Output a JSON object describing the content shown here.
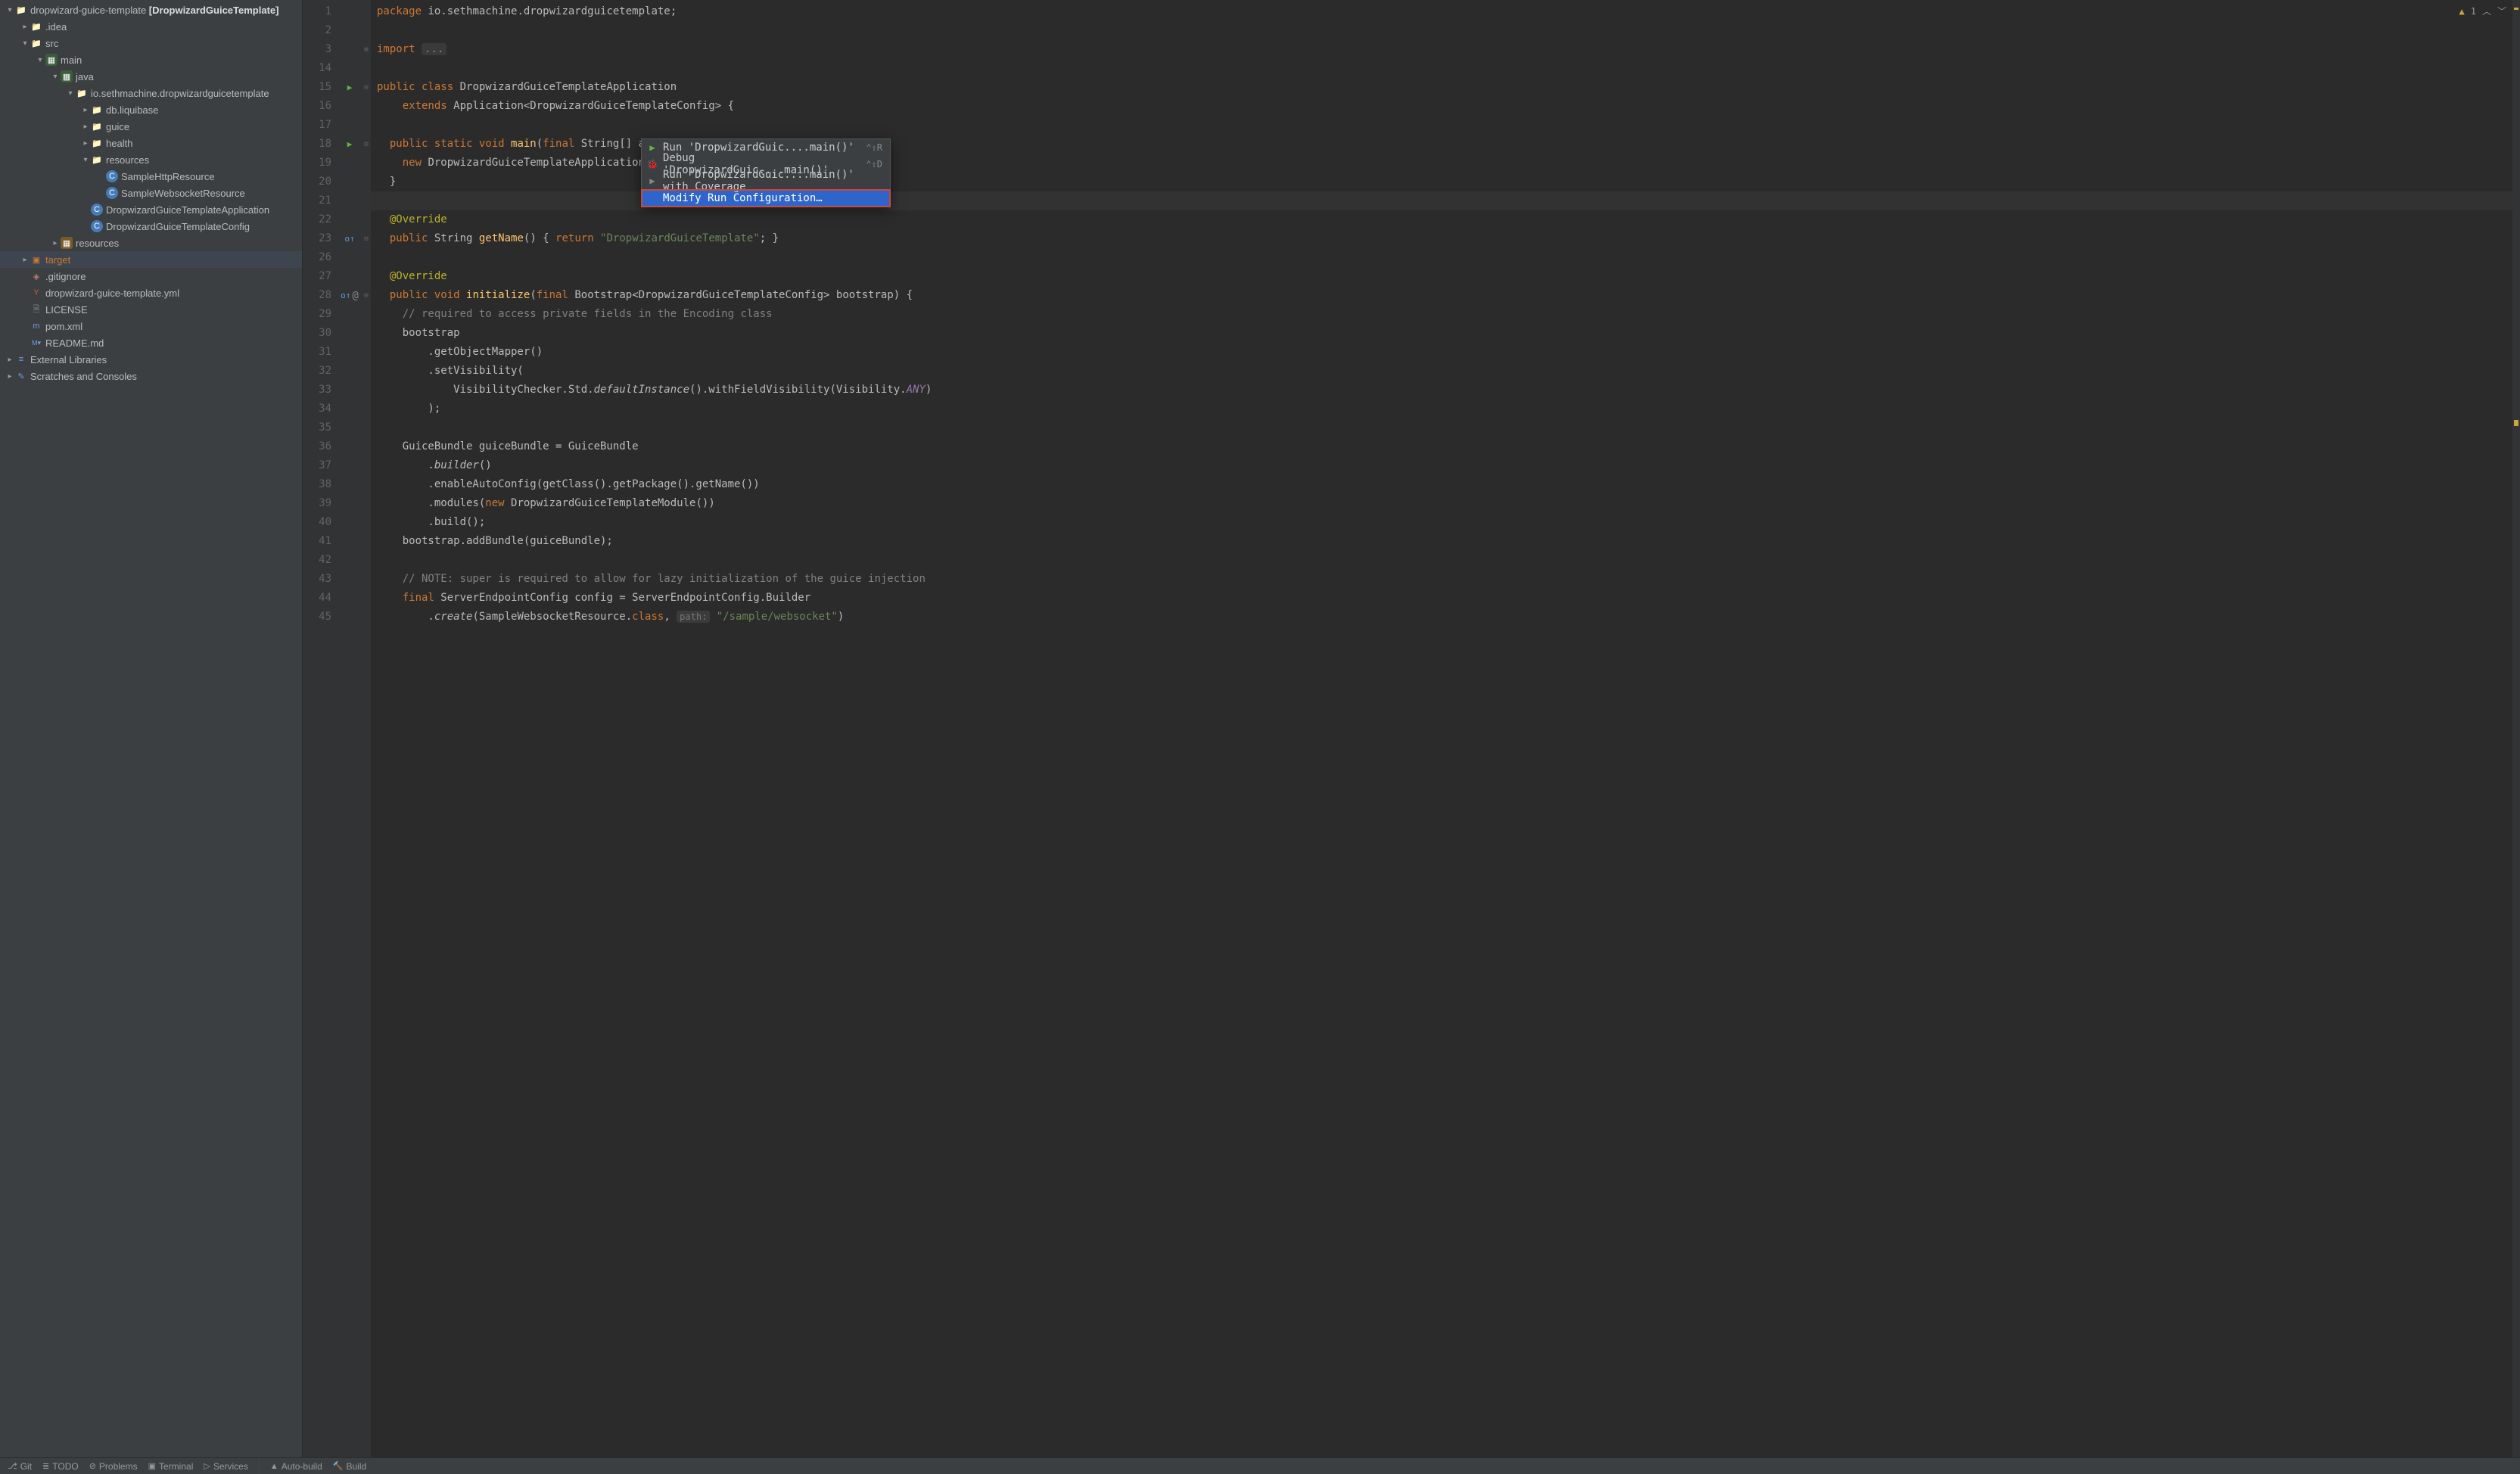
{
  "project_root": {
    "name": "dropwizard-guice-template",
    "bold": "[DropwizardGuiceTemplate]"
  },
  "tree": [
    {
      "d": 0,
      "tw": "▾",
      "ic": "folder",
      "label": "dropwizard-guice-template",
      "extra": " [DropwizardGuiceTemplate]"
    },
    {
      "d": 1,
      "tw": "▸",
      "ic": "folder",
      "label": ".idea"
    },
    {
      "d": 1,
      "tw": "▾",
      "ic": "folder",
      "label": "src"
    },
    {
      "d": 2,
      "tw": "▾",
      "ic": "srcfolder",
      "label": "main"
    },
    {
      "d": 3,
      "tw": "▾",
      "ic": "srcfolder",
      "label": "java"
    },
    {
      "d": 4,
      "tw": "▾",
      "ic": "folder",
      "label": "io.sethmachine.dropwizardguicetemplate"
    },
    {
      "d": 5,
      "tw": "▸",
      "ic": "folder",
      "label": "db.liquibase"
    },
    {
      "d": 5,
      "tw": "▸",
      "ic": "folder",
      "label": "guice"
    },
    {
      "d": 5,
      "tw": "▸",
      "ic": "folder",
      "label": "health"
    },
    {
      "d": 5,
      "tw": "▾",
      "ic": "folder",
      "label": "resources"
    },
    {
      "d": 6,
      "tw": "",
      "ic": "class",
      "label": "SampleHttpResource"
    },
    {
      "d": 6,
      "tw": "",
      "ic": "class",
      "label": "SampleWebsocketResource"
    },
    {
      "d": 5,
      "tw": "",
      "ic": "class",
      "label": "DropwizardGuiceTemplateApplication"
    },
    {
      "d": 5,
      "tw": "",
      "ic": "class",
      "label": "DropwizardGuiceTemplateConfig"
    },
    {
      "d": 3,
      "tw": "▸",
      "ic": "resfolder",
      "label": "resources"
    },
    {
      "d": 1,
      "tw": "▸",
      "ic": "target",
      "label": "target",
      "hl": true
    },
    {
      "d": 1,
      "tw": "",
      "ic": "git",
      "label": ".gitignore"
    },
    {
      "d": 1,
      "tw": "",
      "ic": "yml",
      "label": "dropwizard-guice-template.yml"
    },
    {
      "d": 1,
      "tw": "",
      "ic": "file",
      "label": "LICENSE"
    },
    {
      "d": 1,
      "tw": "",
      "ic": "xml",
      "label": "pom.xml"
    },
    {
      "d": 1,
      "tw": "",
      "ic": "md",
      "label": "README.md"
    },
    {
      "d": 0,
      "tw": "▸",
      "ic": "lib",
      "label": "External Libraries"
    },
    {
      "d": 0,
      "tw": "▸",
      "ic": "scratch",
      "label": "Scratches and Consoles"
    }
  ],
  "inspections": {
    "warnings": "1"
  },
  "code": [
    {
      "n": 1,
      "html": "<span class='kw'>package</span> io.sethmachine.dropwizardguicetemplate;"
    },
    {
      "n": 2,
      "html": ""
    },
    {
      "n": 3,
      "html": "<span class='kw'>import</span> <span class='fold'>...</span>",
      "fold": "+"
    },
    {
      "n": 14,
      "html": ""
    },
    {
      "n": 15,
      "html": "<span class='kw'>public class</span> DropwizardGuiceTemplateApplication",
      "gi": "run",
      "fold": "-"
    },
    {
      "n": 16,
      "html": "    <span class='kw'>extends</span> Application&lt;DropwizardGuiceTemplateConfig&gt; {"
    },
    {
      "n": 17,
      "html": ""
    },
    {
      "n": 18,
      "html": "  <span class='kw'>public static void</span> <span class='fn'>main</span>(<span class='kw'>final</span> String[] args) <span class='kw'>throws</span> Exception {",
      "gi": "run",
      "fold": "-"
    },
    {
      "n": 19,
      "html": "    <span class='kw'>new</span> DropwizardGuiceTemplateApplication().run(args);"
    },
    {
      "n": 20,
      "html": "  }"
    },
    {
      "n": 21,
      "html": "",
      "caret": true
    },
    {
      "n": 22,
      "html": "  <span class='ann'>@Override</span>"
    },
    {
      "n": 23,
      "html": "  <span class='kw'>public</span> String <span class='fn'>getName</span>() { <span class='kw'>return</span> <span class='str'>\"DropwizardGuiceTemplate\"</span>; }",
      "gi": "ov",
      "fold": "-"
    },
    {
      "n": 26,
      "html": ""
    },
    {
      "n": 27,
      "html": "  <span class='ann'>@Override</span>"
    },
    {
      "n": 28,
      "html": "  <span class='kw'>public void</span> <span class='fn'>initialize</span>(<span class='kw'>final</span> Bootstrap&lt;DropwizardGuiceTemplateConfig&gt; bootstrap) {",
      "gi": "ov",
      "giextra": "@",
      "fold": "-"
    },
    {
      "n": 29,
      "html": "    <span class='com'>// required to access private fields in the Encoding class</span>"
    },
    {
      "n": 30,
      "html": "    bootstrap"
    },
    {
      "n": 31,
      "html": "        .getObjectMapper()"
    },
    {
      "n": 32,
      "html": "        .setVisibility("
    },
    {
      "n": 33,
      "html": "            VisibilityChecker.Std.<span class='it'>defaultInstance</span>().withFieldVisibility(Visibility.<span class='fld it'>ANY</span>)"
    },
    {
      "n": 34,
      "html": "        );"
    },
    {
      "n": 35,
      "html": ""
    },
    {
      "n": 36,
      "html": "    GuiceBundle guiceBundle = GuiceBundle"
    },
    {
      "n": 37,
      "html": "        .<span class='it'>builder</span>()"
    },
    {
      "n": 38,
      "html": "        .enableAutoConfig(getClass().getPackage().getName())"
    },
    {
      "n": 39,
      "html": "        .modules(<span class='kw'>new</span> DropwizardGuiceTemplateModule())"
    },
    {
      "n": 40,
      "html": "        .build();"
    },
    {
      "n": 41,
      "html": "    bootstrap.addBundle(guiceBundle);"
    },
    {
      "n": 42,
      "html": ""
    },
    {
      "n": 43,
      "html": "    <span class='com'>// NOTE: super is required to allow for lazy initialization of the guice injection</span>"
    },
    {
      "n": 44,
      "html": "    <span class='kw'>final</span> ServerEndpointConfig config = ServerEndpointConfig.Builder"
    },
    {
      "n": 45,
      "html": "        .<span class='it'>create</span>(SampleWebsocketResource.<span class='kw'>class</span>, <span class='param-hint'>path:</span> <span class='str'>\"/sample/websocket\"</span>)"
    }
  ],
  "context_menu": {
    "items": [
      {
        "icon": "▶",
        "iconColor": "#62b543",
        "label": "Run 'DropwizardGuic....main()'",
        "shortcut": "⌃⇧R"
      },
      {
        "icon": "🐞",
        "iconColor": "#62b543",
        "label": "Debug 'DropwizardGuic....main()'",
        "shortcut": "⌃⇧D"
      },
      {
        "icon": "▶",
        "iconColor": "#888",
        "label": "Run 'DropwizardGuic....main()' with Coverage",
        "shortcut": ""
      },
      {
        "sep": true
      },
      {
        "icon": "",
        "label": "Modify Run Configuration…",
        "shortcut": "",
        "selected": true
      }
    ]
  },
  "status": {
    "git": "Git",
    "todo": "TODO",
    "problems": "Problems",
    "terminal": "Terminal",
    "services": "Services",
    "autobuild": "Auto-build",
    "build": "Build"
  }
}
